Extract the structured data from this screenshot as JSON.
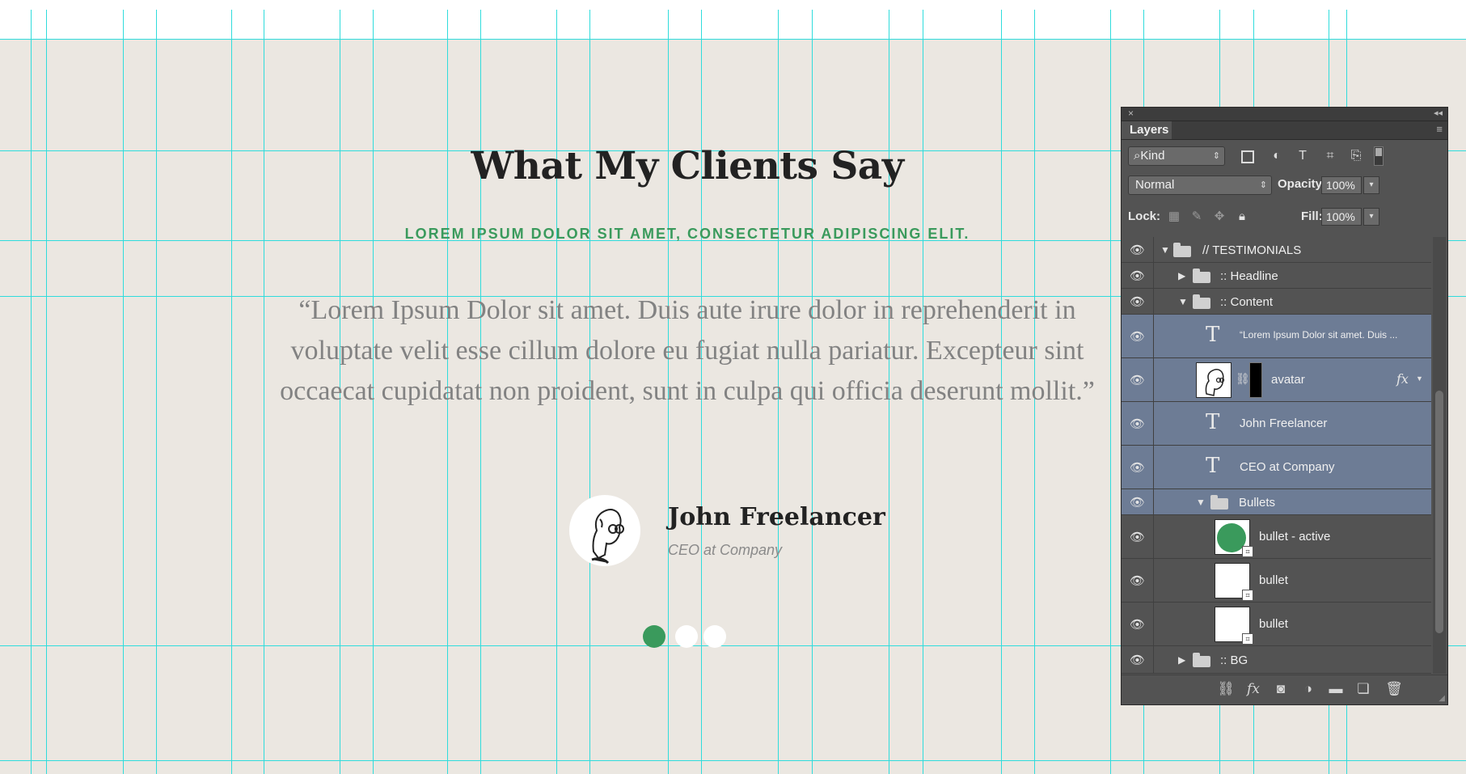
{
  "page": {
    "title": "What My Clients Say",
    "subtitle": "LOREM IPSUM DOLOR SIT AMET, CONSECTETUR ADIPISCING ELIT.",
    "quote": "“Lorem Ipsum Dolor sit amet. Duis aute irure dolor in reprehenderit in voluptate velit esse cillum dolore eu fugiat nulla pariatur. Excepteur sint occaecat cupidatat non proident, sunt in culpa qui officia deserunt mollit.”",
    "person_name": "John Freelancer",
    "person_role": "CEO at Company",
    "bullets_active_index": 0,
    "accent_color": "#3a9a5c"
  },
  "layers_panel": {
    "close_glyph": "×",
    "collapse_glyph": "◂◂",
    "tab": "Layers",
    "menu_glyph": "≡",
    "filter_kind": "Kind",
    "blend_mode": "Normal",
    "opacity_label": "Opacity:",
    "opacity_value": "100%",
    "lock_label": "Lock:",
    "fill_label": "Fill:",
    "fill_value": "100%",
    "layers": [
      {
        "name": "// TESTIMONIALS",
        "type": "group",
        "expanded": true,
        "selected": false
      },
      {
        "name": ":: Headline",
        "type": "group",
        "expanded": false,
        "selected": false
      },
      {
        "name": ":: Content",
        "type": "group",
        "expanded": true,
        "selected": false
      },
      {
        "name": "“Lorem Ipsum Dolor sit amet. Duis ...",
        "type": "text",
        "selected": true
      },
      {
        "name": "avatar",
        "type": "smart-with-mask",
        "selected": true
      },
      {
        "name": "John Freelancer",
        "type": "text",
        "selected": true
      },
      {
        "name": "CEO at Company",
        "type": "text",
        "selected": true
      },
      {
        "name": "Bullets",
        "type": "group",
        "expanded": true,
        "selected": true
      },
      {
        "name": "bullet - active",
        "type": "shape",
        "selected": false
      },
      {
        "name": "bullet",
        "type": "shape",
        "selected": false
      },
      {
        "name": "bullet",
        "type": "shape",
        "selected": false
      },
      {
        "name": ":: BG",
        "type": "group",
        "expanded": false,
        "selected": false
      }
    ]
  }
}
